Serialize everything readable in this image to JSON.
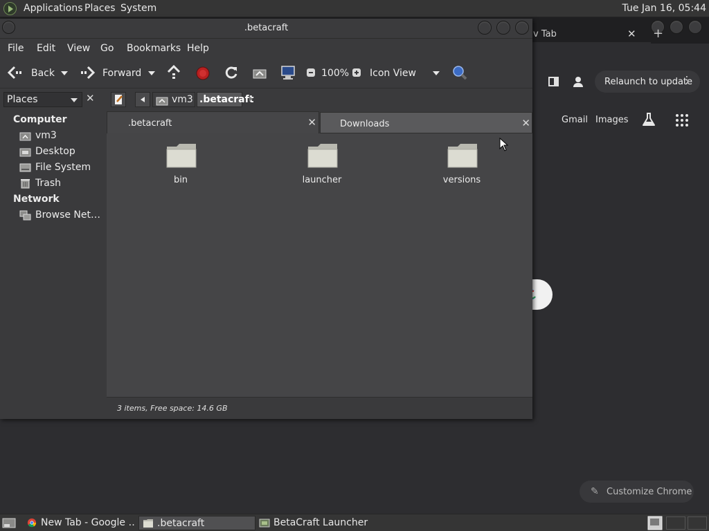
{
  "top_panel": {
    "menus": [
      "Applications",
      "Places",
      "System"
    ],
    "clock": "Tue Jan 16, 05:44"
  },
  "chrome": {
    "tab_title": "v Tab",
    "tab_close": "✕",
    "new_tab": "+",
    "relaunch_label": "Relaunch to update",
    "relaunch_more": "⋮",
    "gmail": "Gmail",
    "images": "Images",
    "customize_label": "Customize Chrome",
    "customize_icon": "✎"
  },
  "file_manager": {
    "title": ".betacraft",
    "menu": [
      "File",
      "Edit",
      "View",
      "Go",
      "Bookmarks",
      "Help"
    ],
    "toolbar": {
      "back": "Back",
      "forward": "Forward",
      "zoom": "100%",
      "view_mode": "Icon View"
    },
    "location": {
      "places_label": "Places",
      "places_close": "✕",
      "crumbs": [
        "vm3",
        ".betacraft"
      ]
    },
    "sidebar": {
      "computer_heading": "Computer",
      "computer_items": [
        {
          "label": "vm3",
          "icon": "home-folder-icon"
        },
        {
          "label": "Desktop",
          "icon": "desktop-icon"
        },
        {
          "label": "File System",
          "icon": "drive-icon"
        },
        {
          "label": "Trash",
          "icon": "trash-icon"
        }
      ],
      "network_heading": "Network",
      "network_items": [
        {
          "label": "Browse Net…",
          "icon": "network-icon"
        }
      ]
    },
    "tabs": [
      {
        "label": ".betacraft",
        "close": "✕"
      },
      {
        "label": "Downloads",
        "close": "✕"
      }
    ],
    "folders": [
      "bin",
      "launcher",
      "versions"
    ],
    "status": "3 items, Free space: 14.6 GB"
  },
  "taskbar": {
    "tasks": [
      {
        "label": "New Tab - Google …",
        "icon": "chrome-icon"
      },
      {
        "label": ".betacraft",
        "icon": "folder-icon"
      },
      {
        "label": "BetaCraft Launcher …",
        "icon": "launcher-icon"
      }
    ]
  },
  "colors": {
    "panel": "#353535",
    "window": "#3a3a3c",
    "icon_area": "#454547",
    "folder": "#d7d7cc",
    "record_red": "#b82020"
  }
}
